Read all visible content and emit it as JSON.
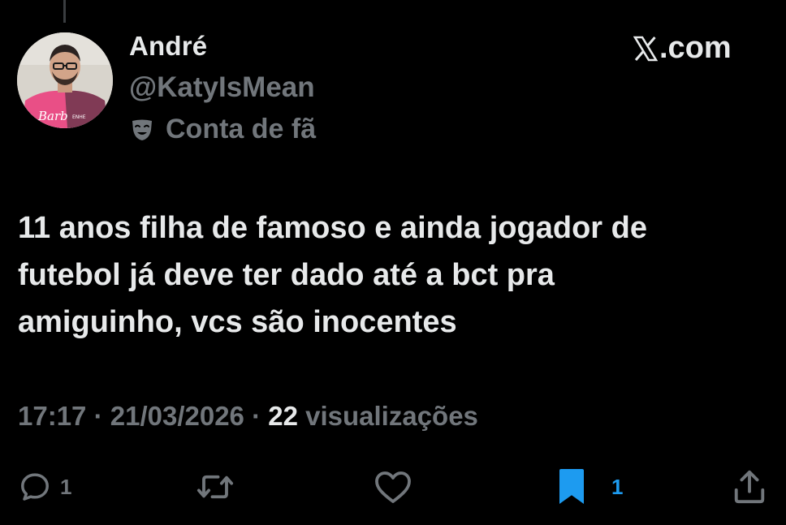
{
  "author": {
    "name": "André",
    "handle": "@KatyIsMean",
    "label": "Conta de fã",
    "label_icon": "theater-masks-icon",
    "avatar_text": "Barb",
    "avatar_text_small": "ENHE"
  },
  "brand": {
    "logo": "x-logo-icon",
    "suffix": ".com"
  },
  "tweet": {
    "lines": [
      "11 anos filha de famoso e ainda jogador de",
      "futebol já deve ter dado até a bct pra",
      "amiguinho, vcs são inocentes"
    ]
  },
  "meta": {
    "time": "17:17",
    "separator_1": " · ",
    "date": "21/03/2026",
    "separator_2": " · ",
    "views_count": "22",
    "views_label": " visualizações"
  },
  "actions": {
    "reply_count": "1",
    "bookmark_count": "1"
  },
  "colors": {
    "background": "#000000",
    "text_primary": "#e7e9ea",
    "text_secondary": "#71767b",
    "accent": "#1d9bf0"
  }
}
